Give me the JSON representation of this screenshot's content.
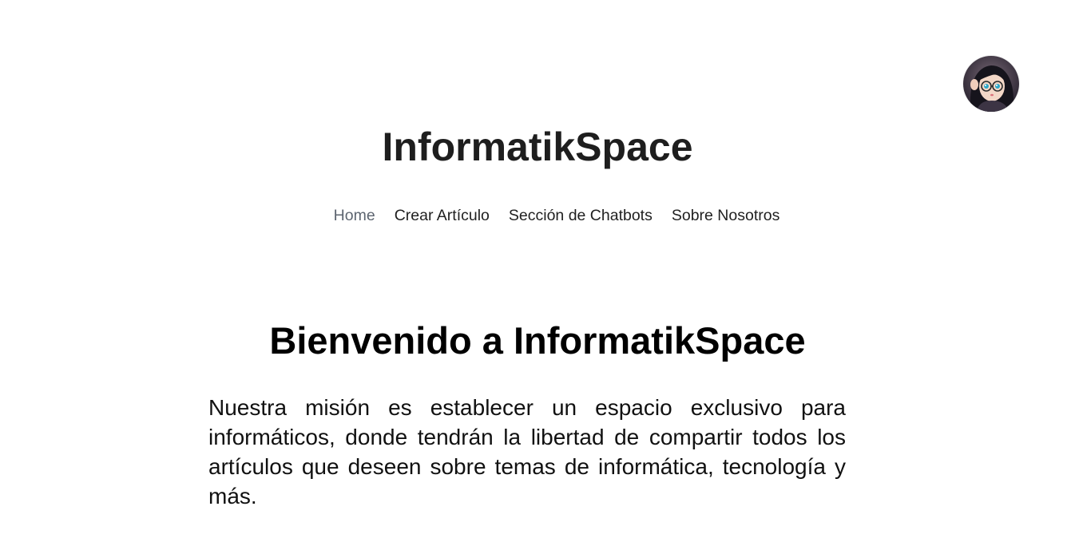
{
  "header": {
    "site_title": "InformatikSpace",
    "avatar_icon": "user-avatar-icon"
  },
  "nav": {
    "items": [
      {
        "label": "Home",
        "active": true
      },
      {
        "label": "Crear Artículo",
        "active": false
      },
      {
        "label": "Sección de Chatbots",
        "active": false
      },
      {
        "label": "Sobre Nosotros",
        "active": false
      }
    ]
  },
  "main": {
    "title": "Bienvenido a InformatikSpace",
    "mission": "Nuestra misión es establecer un espacio exclusivo para informáticos, donde tendrán la libertad de compartir todos los artículos que deseen sobre temas de informática, tecnología y más."
  },
  "colors": {
    "background": "#ffffff",
    "text": "#1f1f1f",
    "nav_active": "#5d6570"
  }
}
